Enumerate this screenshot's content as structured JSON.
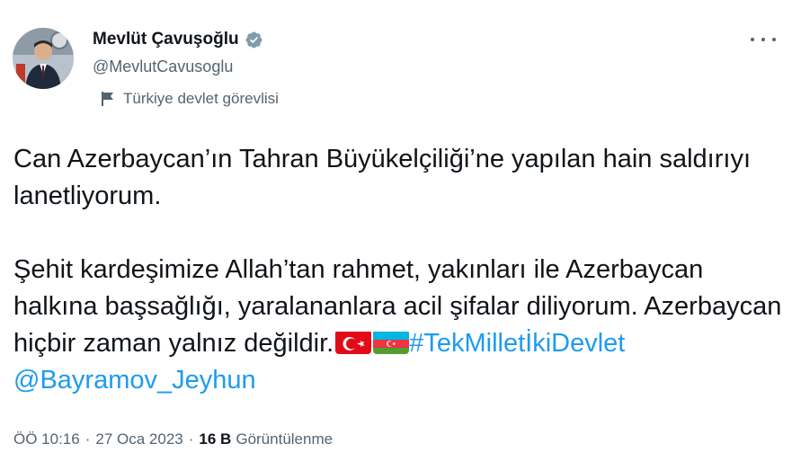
{
  "author": {
    "name": "Mevlüt Çavuşoğlu",
    "handle": "@MevlutCavusoglu",
    "label": "Türkiye devlet görevlisi"
  },
  "tweet": {
    "paragraph1": "Can Azerbaycan’ın Tahran Büyükelçiliği’ne yapılan hain saldırıyı lanetliyorum.",
    "paragraph2_text": "Şehit kardeşimize Allah’tan rahmet, yakınları ile Azerbaycan halkına başsağlığı, yaralananlara acil şifalar diliyorum. Azerbaycan hiçbir zaman yalnız değildir.",
    "hashtag": "#TekMilletİkiDevlet",
    "mention": "@Bayramov_Jeyhun",
    "flags": [
      "turkey-flag",
      "azerbaijan-flag"
    ]
  },
  "meta": {
    "time": "ÖÖ 10:16",
    "separator": "·",
    "date": "27 Oca 2023",
    "views_count": "16 B",
    "views_label": "Görüntülenme"
  },
  "colors": {
    "link": "#1d9bf0",
    "verified": "#829aab",
    "secondary_text": "#536471"
  }
}
